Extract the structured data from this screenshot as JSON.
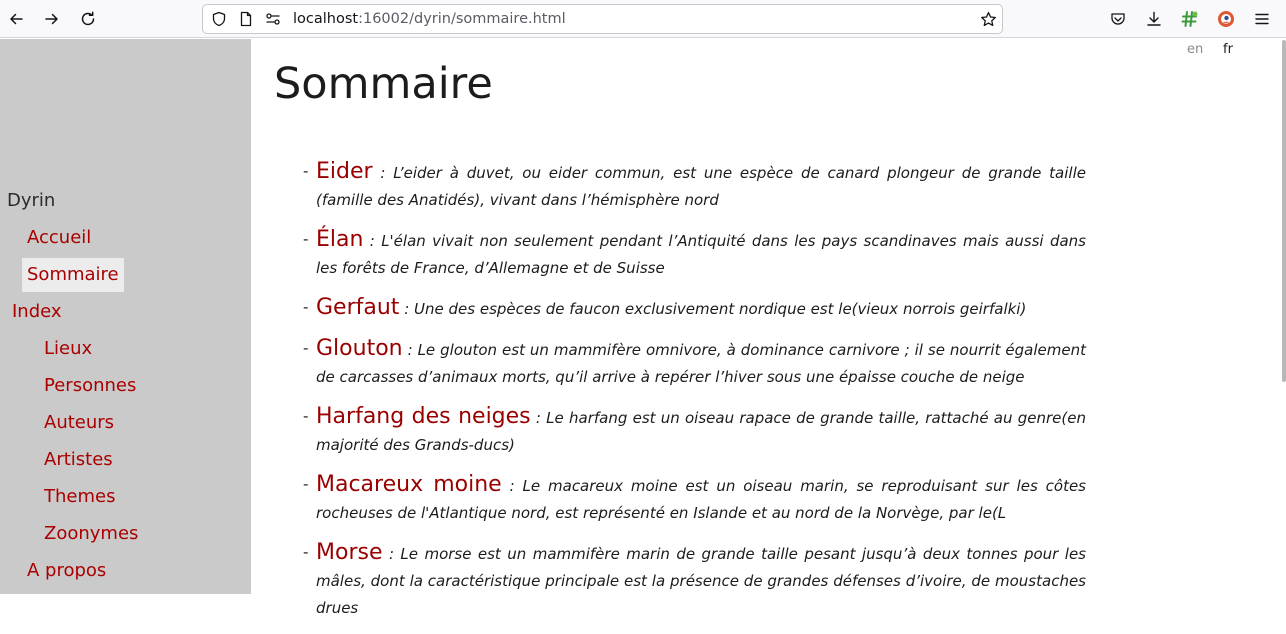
{
  "browser": {
    "url_host": "localhost",
    "url_rest": ":16002/dyrin/sommaire.html"
  },
  "sidebar": {
    "site_title": "Dyrin",
    "items": [
      {
        "label": "Accueil"
      },
      {
        "label": "Sommaire"
      },
      {
        "label": "Index"
      },
      {
        "label": "Lieux"
      },
      {
        "label": "Personnes"
      },
      {
        "label": "Auteurs"
      },
      {
        "label": "Artistes"
      },
      {
        "label": "Themes"
      },
      {
        "label": "Zoonymes"
      },
      {
        "label": "A propos"
      }
    ],
    "active_item": "Sommaire"
  },
  "languages": {
    "en": "en",
    "fr": "fr",
    "current": "fr"
  },
  "main": {
    "title": "Sommaire",
    "entries": [
      {
        "name": "Eider",
        "desc": ": L’eider à duvet, ou eider commun, est une espèce de canard plongeur de grande taille (famille des Anatidés), vivant dans l’hémisphère nord"
      },
      {
        "name": "Élan",
        "desc": ": L'élan vivait non seulement pendant l’Antiquité dans les pays scandinaves mais aussi dans les forêts de France, d’Allemagne et de Suisse"
      },
      {
        "name": "Gerfaut",
        "desc": ": Une des espèces de faucon exclusivement nordique est le(vieux norrois geirfalki)"
      },
      {
        "name": "Glouton",
        "desc": ": Le glouton est un mammifère omnivore, à dominance carnivore ; il se nourrit également de carcasses d’animaux morts, qu’il arrive à repérer l’hiver sous une épaisse couche de neige"
      },
      {
        "name": "Harfang des neiges",
        "desc": ": Le harfang est un oiseau rapace de grande taille, rattaché au genre(en majorité des Grands-ducs)"
      },
      {
        "name": "Macareux moine",
        "desc": ": Le macareux moine est un oiseau marin, se reproduisant sur les côtes rocheuses de l'Atlantique nord, est représenté en Islande et au nord de la Norvège, par le(L"
      },
      {
        "name": "Morse",
        "desc": ": Le morse est un mammifère marin de grande taille pesant jusqu’à deux tonnes pour les mâles, dont la caractéristique principale est la présence de grandes défenses d’ivoire, de moustaches drues"
      }
    ]
  },
  "colors": {
    "link": "#aa0000",
    "entry_name": "#990000",
    "sidebar_bg": "#cacaca",
    "active_bg": "#ececec"
  }
}
